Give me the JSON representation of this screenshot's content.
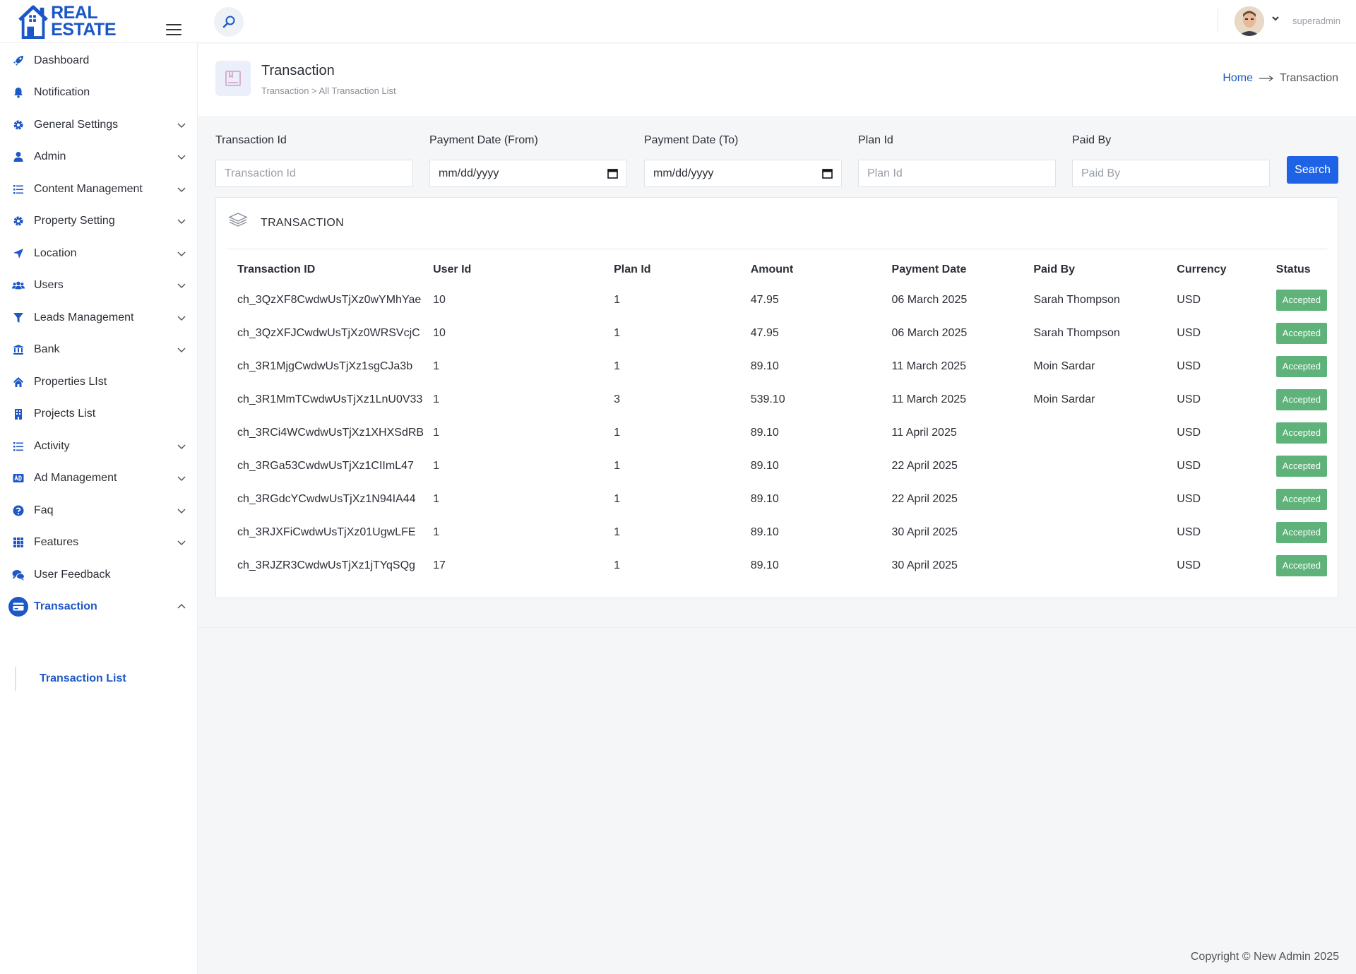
{
  "brand": {
    "line1": "REAL",
    "line2": "ESTATE",
    "color": "#1a56c7"
  },
  "user": {
    "name": "superadmin"
  },
  "sidebar": {
    "items": [
      {
        "label": "Dashboard",
        "icon": "rocket-icon",
        "chevron": false
      },
      {
        "label": "Notification",
        "icon": "bell-icon",
        "chevron": false
      },
      {
        "label": "General Settings",
        "icon": "gear-icon",
        "chevron": true
      },
      {
        "label": "Admin",
        "icon": "user-icon",
        "chevron": true
      },
      {
        "label": "Content Management",
        "icon": "list-icon",
        "chevron": true
      },
      {
        "label": "Property Setting",
        "icon": "gear-icon",
        "chevron": true
      },
      {
        "label": "Location",
        "icon": "location-arrow-icon",
        "chevron": true
      },
      {
        "label": "Users",
        "icon": "users-icon",
        "chevron": true
      },
      {
        "label": "Leads Management",
        "icon": "funnel-icon",
        "chevron": true
      },
      {
        "label": "Bank",
        "icon": "bank-icon",
        "chevron": true
      },
      {
        "label": "Properties LIst",
        "icon": "home-icon",
        "chevron": false
      },
      {
        "label": "Projects List",
        "icon": "building-icon",
        "chevron": false
      },
      {
        "label": "Activity",
        "icon": "list-icon",
        "chevron": true
      },
      {
        "label": "Ad Management",
        "icon": "ad-icon",
        "chevron": true
      },
      {
        "label": "Faq",
        "icon": "question-icon",
        "chevron": true
      },
      {
        "label": "Features",
        "icon": "grid-icon",
        "chevron": true
      },
      {
        "label": "User Feedback",
        "icon": "comments-icon",
        "chevron": false
      },
      {
        "label": "Transaction",
        "icon": "credit-card-icon",
        "chevron": true,
        "active": true
      }
    ],
    "sub_item": "Transaction List"
  },
  "header": {
    "title": "Transaction",
    "subtitle": "Transaction > All Transaction List",
    "breadcrumb_home": "Home",
    "breadcrumb_current": "Transaction"
  },
  "filters": {
    "transaction_id": {
      "label": "Transaction Id",
      "placeholder": "Transaction Id"
    },
    "date_from": {
      "label": "Payment Date (From)",
      "value": "mm/dd/yyyy"
    },
    "date_to": {
      "label": "Payment Date (To)",
      "value": "mm/dd/yyyy"
    },
    "plan_id": {
      "label": "Plan Id",
      "placeholder": "Plan Id"
    },
    "paid_by": {
      "label": "Paid By",
      "placeholder": "Paid By"
    },
    "search_label": "Search"
  },
  "card": {
    "title": "TRANSACTION"
  },
  "table": {
    "columns": [
      "Transaction ID",
      "User Id",
      "Plan Id",
      "Amount",
      "Payment Date",
      "Paid By",
      "Currency",
      "Status"
    ],
    "rows": [
      [
        "ch_3QzXF8CwdwUsTjXz0wYMhYae",
        "10",
        "1",
        "47.95",
        "06 March 2025",
        "Sarah Thompson",
        "USD",
        "Accepted"
      ],
      [
        "ch_3QzXFJCwdwUsTjXz0WRSVcjC",
        "10",
        "1",
        "47.95",
        "06 March 2025",
        "Sarah Thompson",
        "USD",
        "Accepted"
      ],
      [
        "ch_3R1MjgCwdwUsTjXz1sgCJa3b",
        "1",
        "1",
        "89.10",
        "11 March 2025",
        "Moin Sardar",
        "USD",
        "Accepted"
      ],
      [
        "ch_3R1MmTCwdwUsTjXz1LnU0V33",
        "1",
        "3",
        "539.10",
        "11 March 2025",
        "Moin Sardar",
        "USD",
        "Accepted"
      ],
      [
        "ch_3RCi4WCwdwUsTjXz1XHXSdRB",
        "1",
        "1",
        "89.10",
        "11 April 2025",
        "",
        "USD",
        "Accepted"
      ],
      [
        "ch_3RGa53CwdwUsTjXz1CIImL47",
        "1",
        "1",
        "89.10",
        "22 April 2025",
        "",
        "USD",
        "Accepted"
      ],
      [
        "ch_3RGdcYCwdwUsTjXz1N94IA44",
        "1",
        "1",
        "89.10",
        "22 April 2025",
        "",
        "USD",
        "Accepted"
      ],
      [
        "ch_3RJXFiCwdwUsTjXz01UgwLFE",
        "1",
        "1",
        "89.10",
        "30 April 2025",
        "",
        "USD",
        "Accepted"
      ],
      [
        "ch_3RJZR3CwdwUsTjXz1jTYqSQg",
        "17",
        "1",
        "89.10",
        "30 April 2025",
        "",
        "USD",
        "Accepted"
      ]
    ]
  },
  "footer": {
    "copyright": "Copyright © New Admin 2025"
  },
  "colors": {
    "accent": "#1e57c6",
    "button": "#1e63e6",
    "status_accepted": "#5fb37a"
  }
}
